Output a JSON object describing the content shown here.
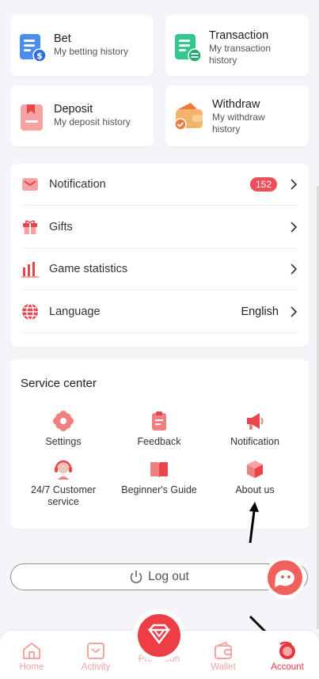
{
  "history": [
    {
      "title": "Bet",
      "subtitle": "My betting history",
      "icon": "bet-document-icon"
    },
    {
      "title": "Transaction",
      "subtitle": "My transaction history",
      "icon": "transaction-document-icon"
    },
    {
      "title": "Deposit",
      "subtitle": "My deposit history",
      "icon": "deposit-bookmark-icon"
    },
    {
      "title": "Withdraw",
      "subtitle": "My withdraw history",
      "icon": "withdraw-wallet-icon"
    }
  ],
  "menu": [
    {
      "label": "Notification",
      "badge": "152",
      "icon": "mail-icon"
    },
    {
      "label": "Gifts",
      "icon": "gift-icon"
    },
    {
      "label": "Game statistics",
      "icon": "bar-chart-icon"
    },
    {
      "label": "Language",
      "value": "English",
      "icon": "globe-icon"
    }
  ],
  "service": {
    "title": "Service center",
    "items": [
      {
        "label": "Settings",
        "icon": "settings-flower-icon"
      },
      {
        "label": "Feedback",
        "icon": "feedback-clipboard-icon"
      },
      {
        "label": "Notification",
        "icon": "megaphone-icon"
      },
      {
        "label": "24/7 Customer service",
        "icon": "customer-service-headset-icon"
      },
      {
        "label": "Beginner's Guide",
        "icon": "book-icon"
      },
      {
        "label": "About us",
        "icon": "cube-icon"
      }
    ]
  },
  "logout": {
    "label": "Log out"
  },
  "nav": {
    "home": "Home",
    "activity": "Activity",
    "promotion": "Promotion",
    "wallet": "Wallet",
    "account": "Account",
    "active": "Account"
  },
  "colors": {
    "accent": "#ee3d45",
    "tab_inactive": "#f2a5a3",
    "badge": "#ee4e59"
  }
}
